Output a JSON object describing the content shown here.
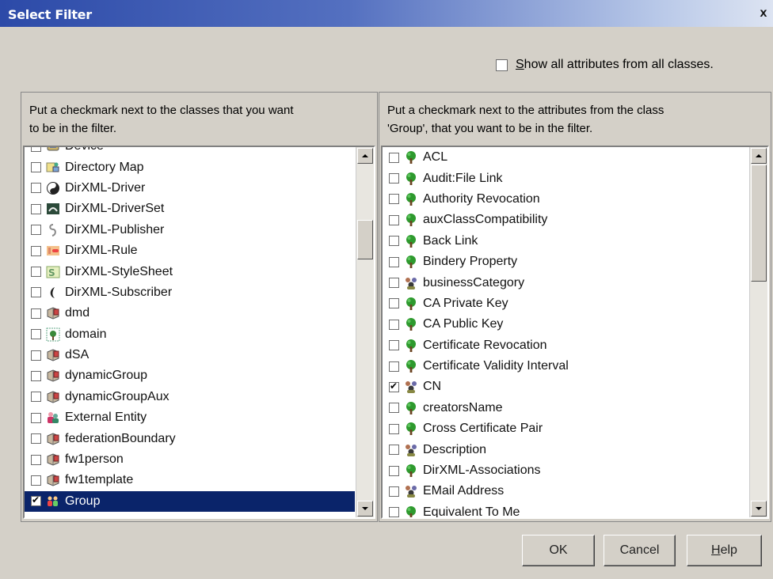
{
  "window": {
    "title": "Select Filter",
    "close_label": "x"
  },
  "show_all": {
    "label_underlined": "S",
    "label_rest": "how all attributes from all classes.",
    "checked": false
  },
  "left": {
    "instruction_line1": "Put a checkmark next to the classes that you want",
    "instruction_line2": "to be in the filter.",
    "items": [
      {
        "label": "Device",
        "icon": "device-icon",
        "checked": false
      },
      {
        "label": "Directory Map",
        "icon": "directory-map-icon",
        "checked": false
      },
      {
        "label": "DirXML-Driver",
        "icon": "dirxml-driver-icon",
        "checked": false
      },
      {
        "label": "DirXML-DriverSet",
        "icon": "dirxml-driverset-icon",
        "checked": false
      },
      {
        "label": "DirXML-Publisher",
        "icon": "dirxml-publisher-icon",
        "checked": false
      },
      {
        "label": "DirXML-Rule",
        "icon": "dirxml-rule-icon",
        "checked": false
      },
      {
        "label": "DirXML-StyleSheet",
        "icon": "dirxml-stylesheet-icon",
        "checked": false
      },
      {
        "label": "DirXML-Subscriber",
        "icon": "dirxml-subscriber-icon",
        "checked": false
      },
      {
        "label": "dmd",
        "icon": "object-class-icon",
        "checked": false
      },
      {
        "label": "domain",
        "icon": "domain-icon",
        "checked": false
      },
      {
        "label": "dSA",
        "icon": "object-class-icon",
        "checked": false
      },
      {
        "label": "dynamicGroup",
        "icon": "object-class-icon",
        "checked": false
      },
      {
        "label": "dynamicGroupAux",
        "icon": "object-class-icon",
        "checked": false
      },
      {
        "label": "External Entity",
        "icon": "external-entity-icon",
        "checked": false
      },
      {
        "label": "federationBoundary",
        "icon": "object-class-icon",
        "checked": false
      },
      {
        "label": "fw1person",
        "icon": "object-class-icon",
        "checked": false
      },
      {
        "label": "fw1template",
        "icon": "object-class-icon",
        "checked": false
      },
      {
        "label": "Group",
        "icon": "group-icon",
        "checked": true,
        "selected": true
      }
    ]
  },
  "right": {
    "instruction_line1": "Put a checkmark next to the attributes from the class",
    "instruction_line2": "'Group', that you want to be in the filter.",
    "items": [
      {
        "label": "ACL",
        "icon": "attribute-tree-icon",
        "checked": false
      },
      {
        "label": "Audit:File Link",
        "icon": "attribute-tree-icon",
        "checked": false
      },
      {
        "label": "Authority Revocation",
        "icon": "attribute-tree-icon",
        "checked": false
      },
      {
        "label": "auxClassCompatibility",
        "icon": "attribute-tree-icon",
        "checked": false
      },
      {
        "label": "Back Link",
        "icon": "attribute-tree-icon",
        "checked": false
      },
      {
        "label": "Bindery Property",
        "icon": "attribute-tree-icon",
        "checked": false
      },
      {
        "label": "businessCategory",
        "icon": "attribute-people-icon",
        "checked": false
      },
      {
        "label": "CA Private Key",
        "icon": "attribute-tree-icon",
        "checked": false
      },
      {
        "label": "CA Public Key",
        "icon": "attribute-tree-icon",
        "checked": false
      },
      {
        "label": "Certificate Revocation",
        "icon": "attribute-tree-icon",
        "checked": false
      },
      {
        "label": "Certificate Validity Interval",
        "icon": "attribute-tree-icon",
        "checked": false
      },
      {
        "label": "CN",
        "icon": "attribute-people-icon",
        "checked": true
      },
      {
        "label": "creatorsName",
        "icon": "attribute-tree-icon",
        "checked": false
      },
      {
        "label": "Cross Certificate Pair",
        "icon": "attribute-tree-icon",
        "checked": false
      },
      {
        "label": "Description",
        "icon": "attribute-people-icon",
        "checked": false
      },
      {
        "label": "DirXML-Associations",
        "icon": "attribute-tree-icon",
        "checked": false
      },
      {
        "label": "EMail Address",
        "icon": "attribute-people-icon",
        "checked": false
      },
      {
        "label": "Equivalent To Me",
        "icon": "attribute-tree-icon",
        "checked": false
      }
    ]
  },
  "buttons": {
    "ok": "OK",
    "cancel": "Cancel",
    "help_underlined": "H",
    "help_rest": "elp"
  }
}
